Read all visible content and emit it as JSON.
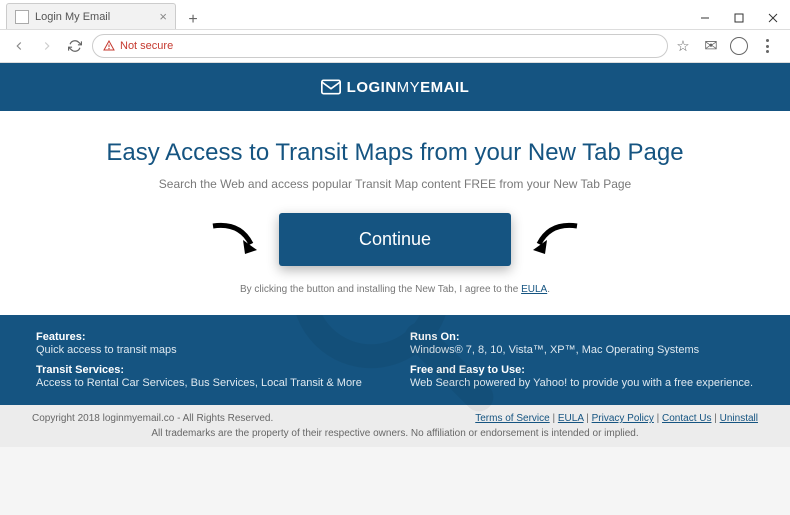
{
  "browser": {
    "tab_title": "Login My Email",
    "not_secure": "Not secure"
  },
  "logo": {
    "text_prefix": "LOGIN",
    "text_mid": "MY",
    "text_suffix": "EMAIL"
  },
  "hero": {
    "headline": "Easy Access to Transit Maps from your New Tab Page",
    "subheadline": "Search the Web and access popular Transit Map content FREE from your New Tab Page",
    "cta_label": "Continue",
    "eula_prefix": "By clicking the button and installing the New Tab, I agree to the ",
    "eula_link": "EULA",
    "eula_suffix": "."
  },
  "features": {
    "col1": {
      "heading1": "Features:",
      "text1": "Quick access to transit maps",
      "heading2": "Transit Services:",
      "text2": "Access to Rental Car Services, Bus Services, Local Transit & More"
    },
    "col2": {
      "heading1": "Runs On:",
      "text1": "Windows® 7, 8, 10, Vista™, XP™, Mac Operating Systems",
      "heading2": "Free and Easy to Use:",
      "text2": "Web Search powered by Yahoo! to provide you with a free experience."
    }
  },
  "footer": {
    "copyright": "Copyright 2018 loginmyemail.co - All Rights Reserved.",
    "links": {
      "tos": "Terms of Service",
      "eula": "EULA",
      "privacy": "Privacy Policy",
      "contact": "Contact Us",
      "uninstall": "Uninstall"
    },
    "disclaimer": "All trademarks are the property of their respective owners. No affiliation or endorsement is intended or implied."
  }
}
